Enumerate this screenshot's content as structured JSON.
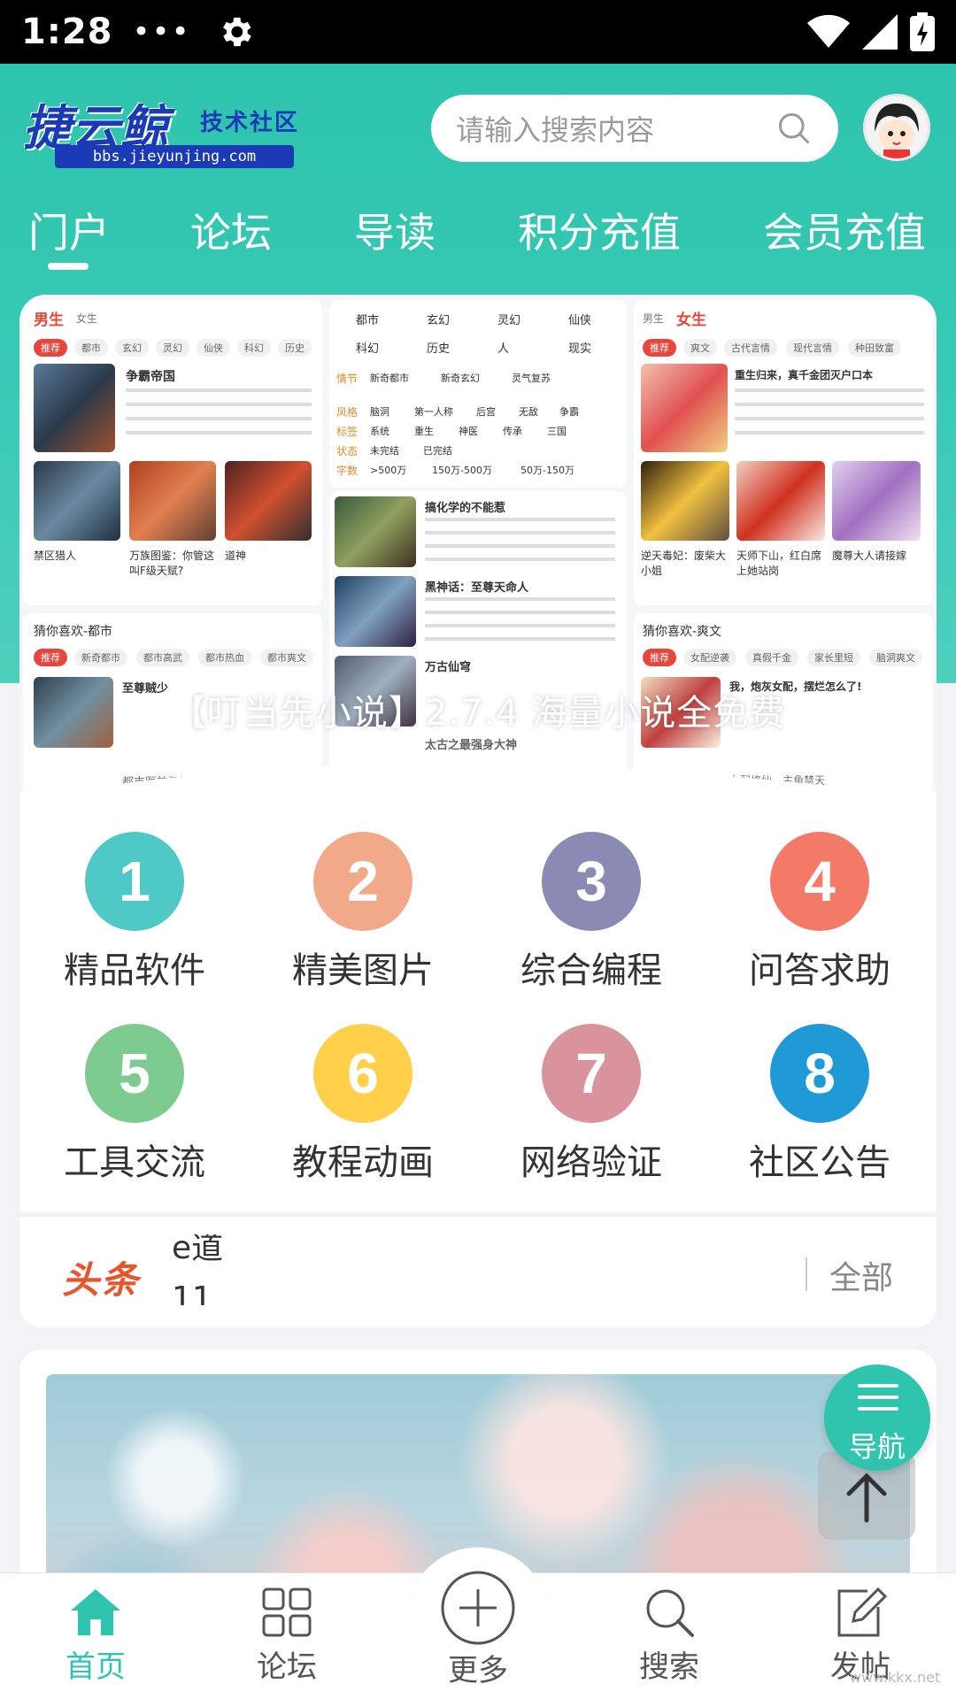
{
  "status_bar": {
    "time": "1:28",
    "dots": "•••"
  },
  "header": {
    "logo": {
      "brand": "捷云鲸",
      "subtitle": "技术社区",
      "url": "bbs.jieyunjing.com"
    },
    "search_placeholder": "请输入搜索内容",
    "nav_tabs": [
      "门户",
      "论坛",
      "导读",
      "积分充值",
      "会员充值"
    ],
    "active_tab": "门户"
  },
  "banner": {
    "caption": "【叮当先小说】2.7.4 海量小说全免费",
    "left_panel": {
      "tabs": [
        "男生",
        "女生"
      ],
      "chips": [
        "推荐",
        "都市",
        "玄幻",
        "灵幻",
        "仙侠",
        "科幻",
        "历史"
      ],
      "featured_title": "争霸帝国",
      "books": [
        "禁区猎人",
        "万族图鉴：你管这叫F级天赋?",
        "道神"
      ],
      "section": "猜你喜欢-都市",
      "section_chips": [
        "推荐",
        "新奇都市",
        "都市高武",
        "都市热血",
        "都市爽文"
      ],
      "section_book": "至尊贼少",
      "last_book": "都市医神狂婿"
    },
    "middle_panel": {
      "genres": [
        "都市",
        "玄幻",
        "灵幻",
        "仙侠",
        "科幻",
        "历史",
        "人",
        "现实"
      ],
      "filters": [
        {
          "label": "情节",
          "values": [
            "新奇都市",
            "新奇玄幻",
            "灵气复苏"
          ]
        },
        {
          "label": "风格",
          "values": [
            "脑洞",
            "第一人称",
            "后宫",
            "无敌",
            "争霸"
          ]
        },
        {
          "label": "标签",
          "values": [
            "系统",
            "重生",
            "神医",
            "传承",
            "三国"
          ]
        },
        {
          "label": "状态",
          "values": [
            "未完结",
            "已完结"
          ]
        },
        {
          "label": "字数",
          "values": [
            ">500万",
            "150万-500万",
            "50万-150万"
          ]
        }
      ],
      "books": [
        "搞化学的不能惹",
        "黑神话：至尊天命人",
        "万古仙穹",
        "太古之最强身大神"
      ]
    },
    "right_panel": {
      "tabs": [
        "男生",
        "女生"
      ],
      "chips": [
        "推荐",
        "爽文",
        "古代言情",
        "现代言情",
        "种田致富"
      ],
      "featured_title": "重生归来，真千金团灭户口本",
      "books": [
        "逆天毒妃：废柴大小姐",
        "天师下山，红白席上她站岗",
        "魔尊大人请接嫁"
      ],
      "section": "猜你喜欢-爽文",
      "section_chips": [
        "推荐",
        "女配逆袭",
        "真假千金",
        "家长里短",
        "脑洞爽文"
      ],
      "section_book": "我，炮灰女配，摆烂怎么了!",
      "last_book": "女配修仙，主角禁天"
    }
  },
  "categories": [
    {
      "num": "1",
      "label": "精品软件",
      "color": "#4ec9c6"
    },
    {
      "num": "2",
      "label": "精美图片",
      "color": "#f2a98a"
    },
    {
      "num": "3",
      "label": "综合编程",
      "color": "#8a8ab5"
    },
    {
      "num": "4",
      "label": "问答求助",
      "color": "#f47a68"
    },
    {
      "num": "5",
      "label": "工具交流",
      "color": "#7ecb92"
    },
    {
      "num": "6",
      "label": "教程动画",
      "color": "#ffd04a"
    },
    {
      "num": "7",
      "label": "网络验证",
      "color": "#d9939a"
    },
    {
      "num": "8",
      "label": "社区公告",
      "color": "#1f9ad6"
    }
  ],
  "headline": {
    "tag": "头条",
    "line1": "e道",
    "line2": "11",
    "all": "全部"
  },
  "fab": {
    "nav_label": "导航"
  },
  "tabbar": {
    "items": [
      {
        "label": "首页",
        "icon": "home-icon",
        "active": true
      },
      {
        "label": "论坛",
        "icon": "grid-icon",
        "active": false
      },
      {
        "label": "更多",
        "icon": "plus-circle-icon",
        "active": false
      },
      {
        "label": "搜索",
        "icon": "search-icon",
        "active": false
      },
      {
        "label": "发帖",
        "icon": "edit-icon",
        "active": false
      }
    ]
  },
  "colors": {
    "accent": "#2ec4ad",
    "brand_blue": "#1a3bb5",
    "headline_red": "#e8542c"
  },
  "watermark": "www.kkx.net"
}
